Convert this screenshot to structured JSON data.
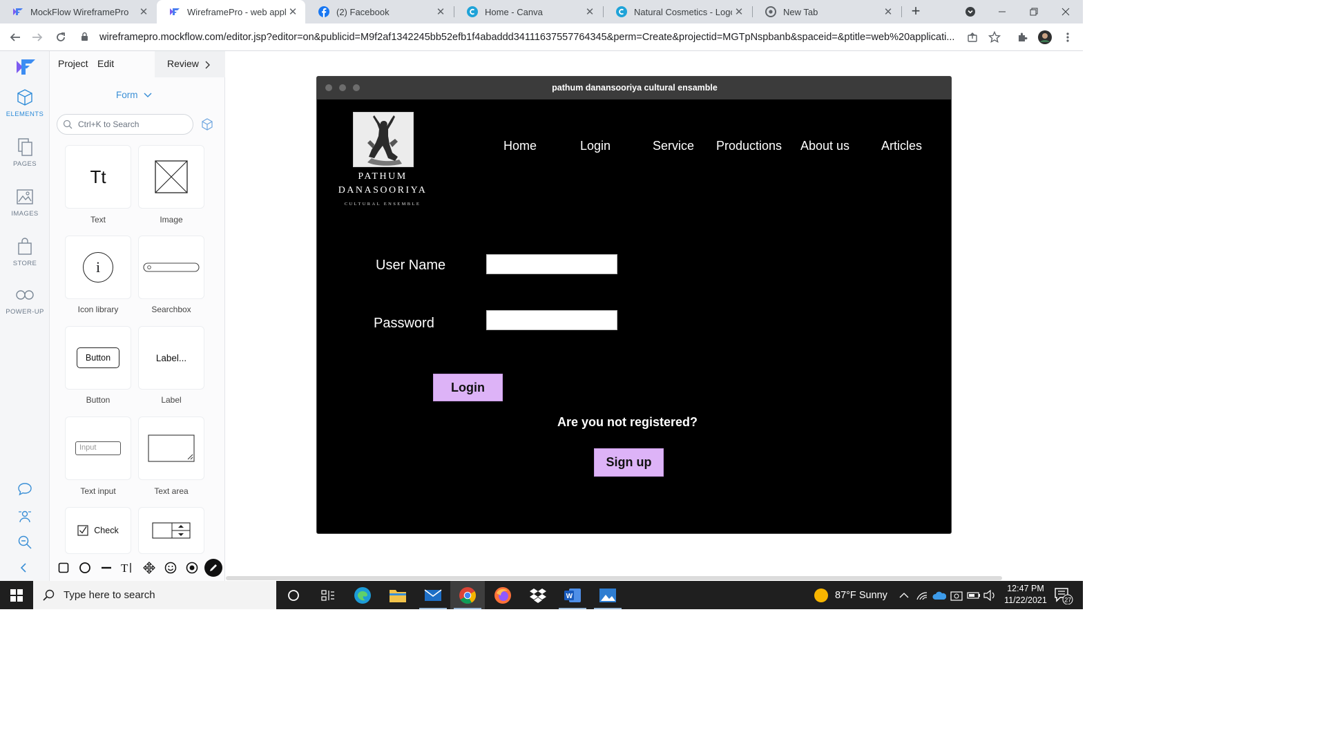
{
  "browser": {
    "tabs": [
      {
        "title": "MockFlow WireframePro",
        "favicon": "mockflow-icon",
        "active": false
      },
      {
        "title": "WireframePro - web applica",
        "favicon": "mockflow-icon",
        "active": true
      },
      {
        "title": "(2) Facebook",
        "favicon": "facebook-icon",
        "active": false
      },
      {
        "title": "Home - Canva",
        "favicon": "canva-icon",
        "active": false
      },
      {
        "title": "Natural Cosmetics - Logo",
        "favicon": "canva-icon",
        "active": false
      },
      {
        "title": "New Tab",
        "favicon": "chrome-icon",
        "active": false
      }
    ],
    "close_glyph": "✕",
    "new_tab_glyph": "+",
    "url": "wireframepro.mockflow.com/editor.jsp?editor=on&publicid=M9f2af1342245bb52efb1f4abaddd34111637557764345&perm=Create&projectid=MGTpNspbanb&spaceid=&ptitle=web%20applicati..."
  },
  "app": {
    "menu": {
      "project": "Project",
      "edit": "Edit",
      "review": "Review"
    },
    "rail": [
      {
        "label": "ELEMENTS",
        "icon": "cube-icon",
        "active": true
      },
      {
        "label": "PAGES",
        "icon": "pages-icon",
        "active": false
      },
      {
        "label": "IMAGES",
        "icon": "image-icon",
        "active": false
      },
      {
        "label": "STORE",
        "icon": "bag-icon",
        "active": false
      },
      {
        "label": "POWER-UP",
        "icon": "infinity-icon",
        "active": false
      }
    ],
    "panel": {
      "category": "Form",
      "search_placeholder": "Ctrl+K to Search",
      "elements": [
        {
          "label": "Text",
          "preview": "Tt"
        },
        {
          "label": "Image",
          "preview": ""
        },
        {
          "label": "Icon library",
          "preview": "i"
        },
        {
          "label": "Searchbox",
          "preview": ""
        },
        {
          "label": "Button",
          "preview": "Button"
        },
        {
          "label": "Label",
          "preview": "Label..."
        },
        {
          "label": "Text input",
          "preview": "Input"
        },
        {
          "label": "Text area",
          "preview": ""
        },
        {
          "label": "",
          "preview": "Check"
        },
        {
          "label": "",
          "preview": ""
        }
      ]
    }
  },
  "mockup": {
    "window_title": "pathum danansooriya cultural ensamble",
    "logo": {
      "line1": "PATHUM",
      "line2": "DANASOORIYA",
      "line3": "CULTURAL ENSEMBLE"
    },
    "nav": [
      "Home",
      "Login",
      "Service",
      "Productions",
      "About us",
      "Articles"
    ],
    "username_label": "User Name",
    "password_label": "Password",
    "login_button": "Login",
    "register_prompt": "Are you not  registered?",
    "signup_button": "Sign up",
    "button_color": "#ddb3f7"
  },
  "taskbar": {
    "search_placeholder": "Type here to search",
    "weather": "87°F  Sunny",
    "time": "12:47 PM",
    "date": "11/22/2021",
    "notification_count": "27"
  }
}
